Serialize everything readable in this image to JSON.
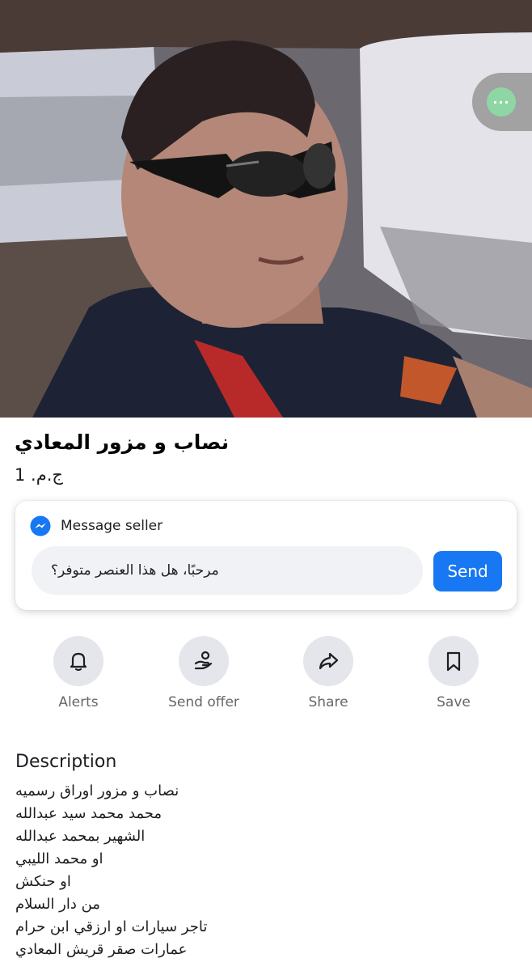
{
  "listing": {
    "title": "نصاب و مزور المعادي",
    "price": "ج.م.‏ 1"
  },
  "overlay": {
    "more_label": "···",
    "more_color": "#8fd6a5"
  },
  "message_card": {
    "header_label": "Message seller",
    "header_icon": "messenger-icon",
    "input_value": "مرحبًا، هل هذا العنصر متوفر؟",
    "send_label": "Send",
    "accent": "#1877f2"
  },
  "actions": [
    {
      "label": "Alerts",
      "icon": "bell-icon"
    },
    {
      "label": "Send offer",
      "icon": "send-offer-icon"
    },
    {
      "label": "Share",
      "icon": "share-icon"
    },
    {
      "label": "Save",
      "icon": "bookmark-icon"
    }
  ],
  "description": {
    "heading": "Description",
    "lines": [
      " نصاب و مزور اوراق رسميه",
      "محمد محمد سيد عبدالله",
      " الشهير بمحمد عبدالله",
      " او محمد الليبي",
      " او حنكش",
      "من دار السلام",
      " تاجر سيارات او ارزقي ابن حرام",
      "عمارات صقر قريش المعادي"
    ]
  }
}
